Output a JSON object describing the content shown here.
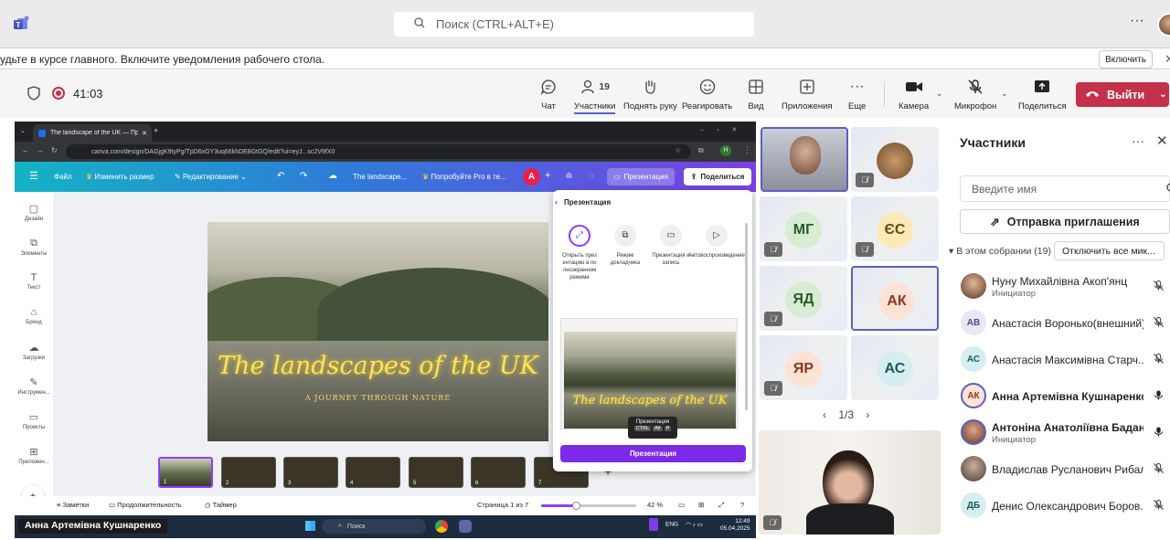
{
  "search": {
    "placeholder": "Поиск (CTRL+ALT+E)"
  },
  "notification": {
    "text": "удьте в курсе главного. Включите уведомления рабочего стола.",
    "button": "Включить"
  },
  "meeting": {
    "timer": "41:03",
    "participants_count": "19",
    "toolbar": {
      "chat": "Чат",
      "participants": "Участники",
      "raise_hand": "Поднять руку",
      "react": "Реагировать",
      "view": "Вид",
      "apps": "Приложения",
      "more": "Еще",
      "camera": "Камера",
      "mic": "Микрофон",
      "share": "Поделиться",
      "leave": "Выйти"
    }
  },
  "browser": {
    "tab_title": "The landscape of the UK — Пр...",
    "url": "canva.com/design/DAGjgK9tyPg/TpD6xGY3uq66khDE8GtGQ/edit?ui=eyJ...sc2V9fX0"
  },
  "canva": {
    "top": {
      "file": "Файл",
      "resize": "Изменить размер",
      "edit": "Редактирование",
      "doc_title": "The landscape...",
      "try_pro": "Попробуйте Pro в те...",
      "avatar": "A",
      "present": "Презентация",
      "share": "Поделиться"
    },
    "side": [
      "Дизайн",
      "Элементы",
      "Текст",
      "Бренд",
      "Загрузки",
      "Инструмен...",
      "Проекты",
      "Приложен..."
    ],
    "slide": {
      "title": "The landscapes of the UK",
      "subtitle": "A JOURNEY THROUGH NATURE"
    },
    "thumbs": [
      "1",
      "2",
      "3",
      "4",
      "5",
      "6",
      "7"
    ],
    "bottom": {
      "notes": "Заметки",
      "duration": "Продолжительность",
      "timer": "Таймер",
      "page": "Страница 1 из 7",
      "zoom": "42 %"
    },
    "zoom_percent": 42,
    "present_panel": {
      "title": "Презентация",
      "options": [
        "Открыть презентацию в полноэкранном режиме",
        "Режим докладчика",
        "Презентация и запись",
        "Автовоспроизведение"
      ],
      "tooltip": "Презентация",
      "keys": [
        "CTRL",
        "Alt",
        "P"
      ],
      "preview_title": "The landscapes of the UK",
      "button": "Презентация"
    }
  },
  "taskbar": {
    "presenter_name": "Анна Артемівна Кушнаренко",
    "search": "Поиск",
    "lang": "ENG",
    "time": "12:49",
    "date": "05.04.2025"
  },
  "video_tiles": [
    {
      "initials": "",
      "color": "#c8d8f0"
    },
    {
      "initials": "",
      "color": "#b8a088"
    },
    {
      "initials": "МГ",
      "color": "#d7ecd2"
    },
    {
      "initials": "ЄС",
      "color": "#fbe9b7"
    },
    {
      "initials": "ЯД",
      "color": "#d7ecd2"
    },
    {
      "initials": "АК",
      "color": "#fde2d6"
    },
    {
      "initials": "ЯР",
      "color": "#fde2d6"
    },
    {
      "initials": "АС",
      "color": "#d6eef0"
    }
  ],
  "pager": "1/3",
  "participants_panel": {
    "title": "Участники",
    "search_placeholder": "Введите имя",
    "invite": "Отправка приглашения",
    "section": "В этом собрании (19)",
    "mute_all": "Отключить все мик...",
    "people": [
      {
        "name": "Нуну Михайлівна Акоп'янц",
        "role": "Инициатор",
        "initials": "",
        "color": "#8a5a40",
        "bold": false
      },
      {
        "name": "Анастасія Воронько(внешний)",
        "role": "",
        "initials": "АВ",
        "color": "#e8e8f4",
        "bold": false
      },
      {
        "name": "Анастасія Максимівна Старч...",
        "role": "",
        "initials": "АС",
        "color": "#d6eef0",
        "bold": false
      },
      {
        "name": "Анна Артемівна Кушнаренко",
        "role": "",
        "initials": "АК",
        "color": "#fde2d6",
        "bold": true
      },
      {
        "name": "Антоніна Анатоліївна Бадан",
        "role": "Инициатор",
        "initials": "",
        "color": "#9a6a50",
        "bold": true
      },
      {
        "name": "Владислав Русланович Рибал...",
        "role": "",
        "initials": "",
        "color": "#7a6a5a",
        "bold": false
      },
      {
        "name": "Денис Олександрович Боров...",
        "role": "",
        "initials": "ДБ",
        "color": "#d6eef0",
        "bold": false
      }
    ]
  },
  "colors": {
    "accent": "#5b5fc7",
    "leave": "#c4314b",
    "canva_purple": "#7d2ae8"
  }
}
